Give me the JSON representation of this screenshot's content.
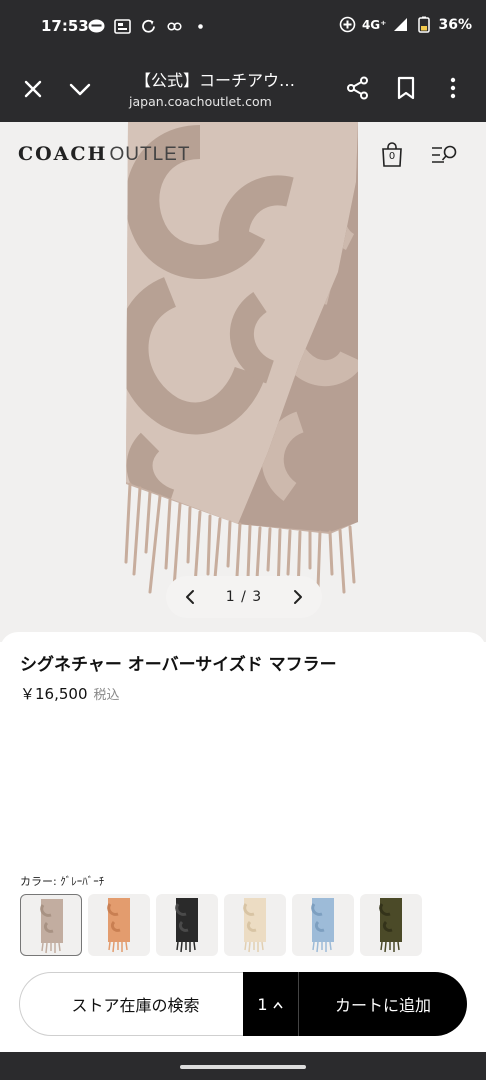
{
  "status_bar": {
    "time": "17:53",
    "network": "4G⁺",
    "battery": "36%",
    "icons_left": [
      "line-icon",
      "sim-icon",
      "sync-icon",
      "infinity-icon",
      "dot-icon"
    ],
    "icons_right": [
      "add-circle-icon",
      "signal-icon",
      "battery-icon"
    ]
  },
  "browser": {
    "title": "【公式】コーチアウ…",
    "url": "japan.coachoutlet.com"
  },
  "site": {
    "logo_brand": "COACH",
    "logo_sub": "OUTLET",
    "bag_count": "0"
  },
  "carousel": {
    "counter": "1 / 3"
  },
  "product": {
    "name": "シグネチャー オーバーサイズド マフラー",
    "price": "￥16,500",
    "tax_note": "税込",
    "color_label": "カラー: ｸﾞﾚｰﾊﾞｰﾁ"
  },
  "swatch_colors": [
    "#c2ada0",
    "#e39c6e",
    "#2a2a2a",
    "#ecdcc3",
    "#9dbbd8",
    "#4b4a28"
  ],
  "actions": {
    "store_stock": "ストア在庫の検索",
    "quantity": "1",
    "add_to_cart": "カートに追加"
  },
  "colors": {
    "chrome_bg": "#2b2b2d",
    "scarf_dark": "#b9a398",
    "scarf_light": "#d4c2b7"
  }
}
